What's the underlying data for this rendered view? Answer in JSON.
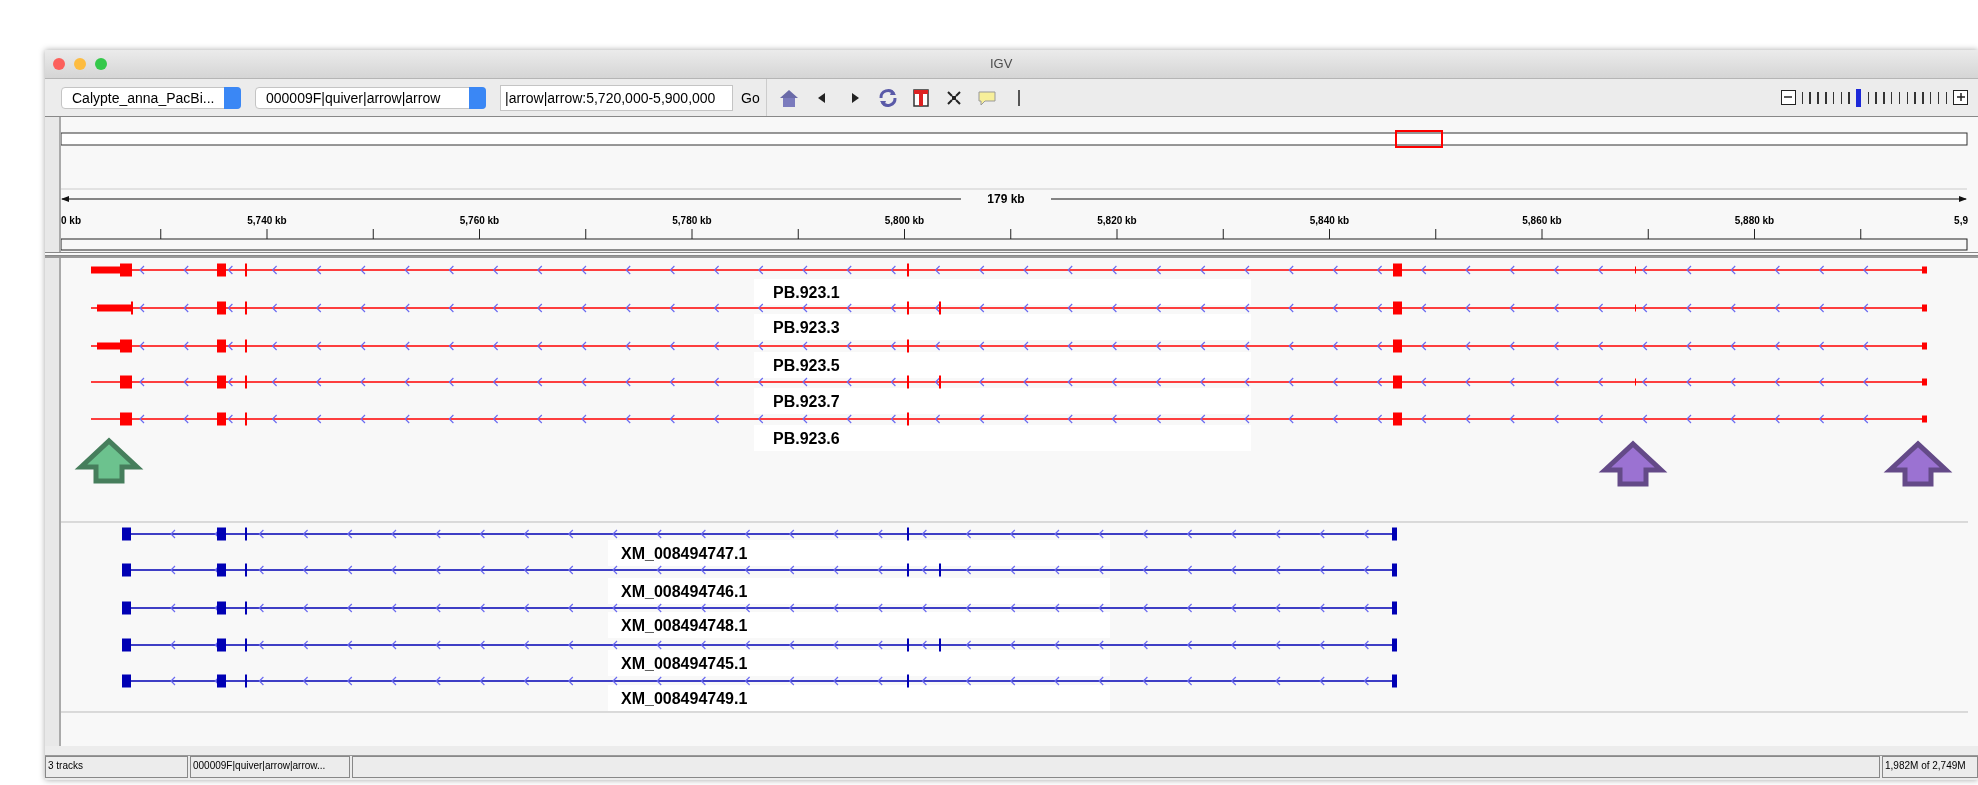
{
  "window": {
    "title": "IGV"
  },
  "toolbar": {
    "genome_dropdown": {
      "value": "Calypte_anna_PacBi..."
    },
    "chromosome_dropdown": {
      "value": "000009F|quiver|arrow|arrow"
    },
    "locus_field": {
      "value": "|arrow|arrow:5,720,000-5,900,000"
    },
    "go_button": "Go",
    "zoom": {
      "level": 0.39
    }
  },
  "ruler": {
    "span_label": "179 kb",
    "tick_labels": [
      "0 kb",
      "5,740 kb",
      "5,760 kb",
      "5,780 kb",
      "5,800 kb",
      "5,820 kb",
      "5,840 kb",
      "5,860 kb",
      "5,880 kb",
      "5,9"
    ]
  },
  "tracks": [
    {
      "color": "#ff0000",
      "features": [
        {
          "name": "PB.923.1"
        },
        {
          "name": "PB.923.3"
        },
        {
          "name": "PB.923.5"
        },
        {
          "name": "PB.923.7"
        },
        {
          "name": "PB.923.6"
        }
      ]
    },
    {
      "color": "#0000b4",
      "features": [
        {
          "name": "XM_008494747.1"
        },
        {
          "name": "XM_008494746.1"
        },
        {
          "name": "XM_008494748.1"
        },
        {
          "name": "XM_008494745.1"
        },
        {
          "name": "XM_008494749.1"
        }
      ]
    }
  ],
  "markers": [
    {
      "color": "#6cc28e"
    },
    {
      "color": "#9b72d2"
    },
    {
      "color": "#9b72d2"
    }
  ],
  "status_bar": [
    "3 tracks",
    "000009F|quiver|arrow|arrow...",
    "1,982M of 2,749M"
  ]
}
